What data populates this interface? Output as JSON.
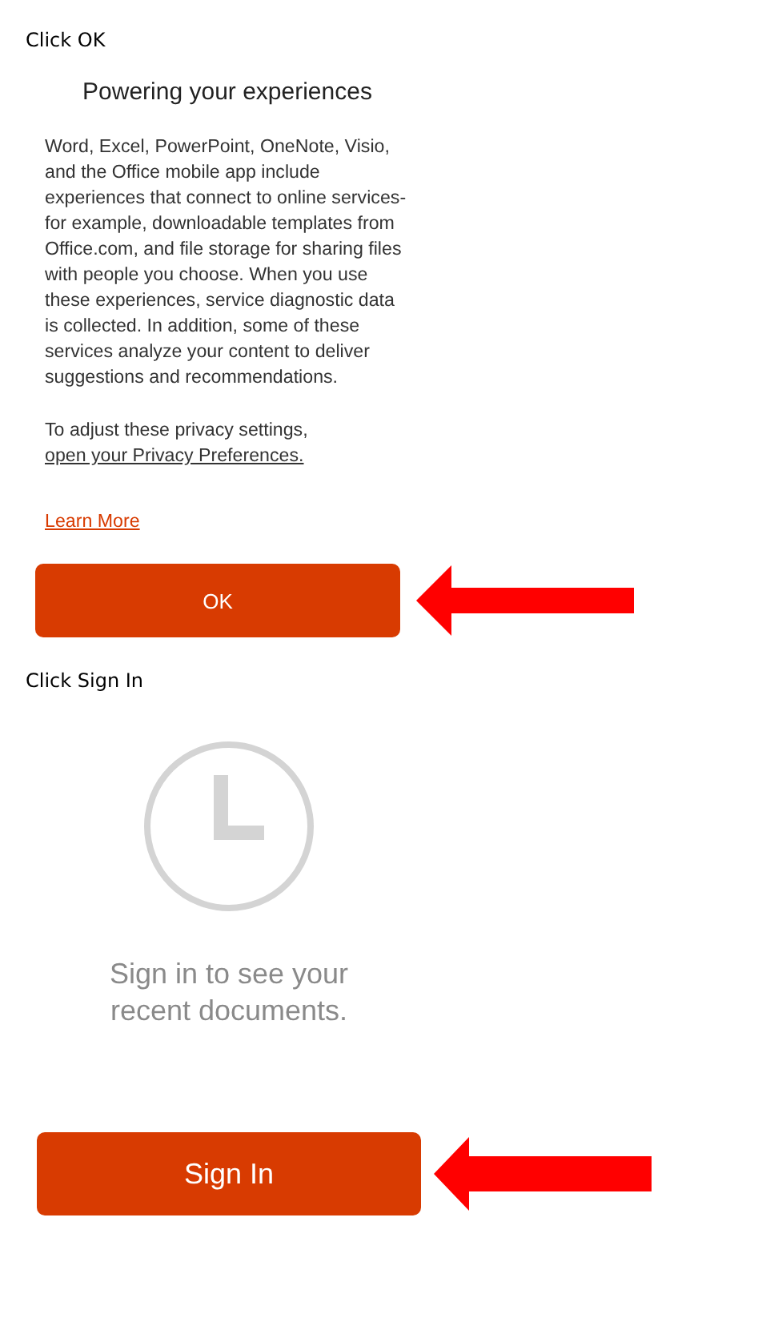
{
  "steps": [
    {
      "kind": "dialog",
      "instruction": "Click OK",
      "title": "Powering your experiences",
      "body": "Word, Excel, PowerPoint, OneNote, Visio, and the Office mobile app include experiences that connect to online services-for example, downloadable templates from Office.com, and file storage for sharing files with people you choose. When you use these experiences, service diagnostic data is collected. In addition, some of these services analyze your content to deliver suggestions and recommendations.",
      "privacy_text": "To adjust these privacy settings,",
      "privacy_link": "open your Privacy Preferences.",
      "learn_more": "Learn More",
      "button": "OK"
    },
    {
      "kind": "signin",
      "instruction": "Click Sign In",
      "message": "Sign in to see your recent documents.",
      "button": "Sign In"
    }
  ]
}
